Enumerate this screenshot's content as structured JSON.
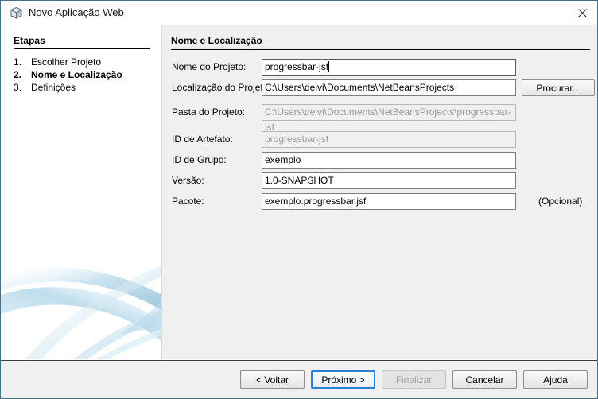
{
  "window": {
    "title": "Novo Aplicação Web",
    "icon": "cube-icon",
    "close_label": "×"
  },
  "sidebar": {
    "heading": "Etapas",
    "steps": [
      {
        "num": "1.",
        "label": "Escolher Projeto",
        "active": false
      },
      {
        "num": "2.",
        "label": "Nome e Localização",
        "active": true
      },
      {
        "num": "3.",
        "label": "Definições",
        "active": false
      }
    ]
  },
  "panel": {
    "title": "Nome e Localização",
    "fields": [
      {
        "label": "Nome do Projeto:",
        "value": "progressbar-jsf",
        "disabled": false,
        "focused": true
      },
      {
        "label": "Localização do Projeto:",
        "value": "C:\\Users\\deivi\\Documents\\NetBeansProjects",
        "disabled": false,
        "focused": false
      },
      {
        "label": "Pasta do Projeto:",
        "value": "C:\\Users\\deivi\\Documents\\NetBeansProjects\\progressbar-jsf",
        "disabled": true,
        "focused": false
      },
      {
        "label": "ID de Artefato:",
        "value": "progressbar-jsf",
        "disabled": true,
        "focused": false
      },
      {
        "label": "ID de Grupo:",
        "value": "exemplo",
        "disabled": false,
        "focused": false
      },
      {
        "label": "Versão:",
        "value": "1.0-SNAPSHOT",
        "disabled": false,
        "focused": false
      },
      {
        "label": "Pacote:",
        "value": "exemplo.progressbar.jsf",
        "disabled": false,
        "focused": false
      }
    ],
    "browse_label": "Procurar...",
    "optional_note": "(Opcional)"
  },
  "footer": {
    "buttons": [
      {
        "label": "< Voltar",
        "state": "normal"
      },
      {
        "label": "Próximo >",
        "state": "focused"
      },
      {
        "label": "Finalizar",
        "state": "disabled"
      },
      {
        "label": "Cancelar",
        "state": "normal"
      },
      {
        "label": "Ajuda",
        "state": "normal"
      }
    ]
  },
  "colors": {
    "panel_bg": "#f0f0f0",
    "sidebar_bg": "#ffffff",
    "focus_blue": "#2f7fd0",
    "swoosh_blue": "#bedcea",
    "window_border": "#4a6f84"
  }
}
